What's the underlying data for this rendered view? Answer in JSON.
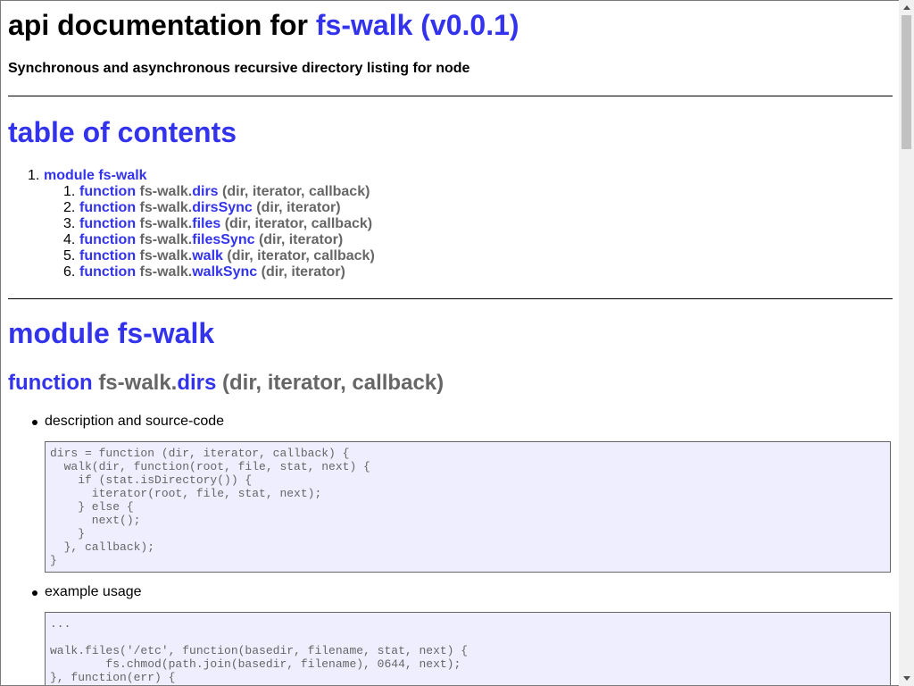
{
  "header": {
    "prefix": "api documentation for",
    "package_link": "fs-walk (v0.0.1)",
    "description": "Synchronous and asynchronous recursive directory listing for node"
  },
  "toc": {
    "title": "table of contents",
    "module": {
      "num": "1.",
      "label": "module fs-walk"
    },
    "items": [
      {
        "num": "1.",
        "kw": "function",
        "ns": "fs-walk.",
        "name": "dirs",
        "args": "(dir, iterator, callback)"
      },
      {
        "num": "2.",
        "kw": "function",
        "ns": "fs-walk.",
        "name": "dirsSync",
        "args": "(dir, iterator)"
      },
      {
        "num": "3.",
        "kw": "function",
        "ns": "fs-walk.",
        "name": "files",
        "args": "(dir, iterator, callback)"
      },
      {
        "num": "4.",
        "kw": "function",
        "ns": "fs-walk.",
        "name": "filesSync",
        "args": "(dir, iterator)"
      },
      {
        "num": "5.",
        "kw": "function",
        "ns": "fs-walk.",
        "name": "walk",
        "args": "(dir, iterator, callback)"
      },
      {
        "num": "6.",
        "kw": "function",
        "ns": "fs-walk.",
        "name": "walkSync",
        "args": "(dir, iterator)"
      }
    ]
  },
  "module_section": {
    "title": "module fs-walk",
    "function": {
      "kw": "function",
      "ns": "fs-walk.",
      "name": "dirs",
      "args": "(dir, iterator, callback)"
    },
    "bullet_source": "description and source-code",
    "source_code": "dirs = function (dir, iterator, callback) {\n  walk(dir, function(root, file, stat, next) {\n    if (stat.isDirectory()) {\n      iterator(root, file, stat, next);\n    } else {\n      next();\n    }\n  }, callback);\n}",
    "bullet_example": "example usage",
    "example_code": "...\n\nwalk.files('/etc', function(basedir, filename, stat, next) {\n        fs.chmod(path.join(basedir, filename), 0644, next);\n}, function(err) {"
  },
  "colors": {
    "link": "#3333ee",
    "muted": "#666666",
    "code_bg": "#eeeeff"
  },
  "icons": {
    "scroll_up": "triangle-up-icon",
    "scroll_down": "triangle-down-icon"
  }
}
